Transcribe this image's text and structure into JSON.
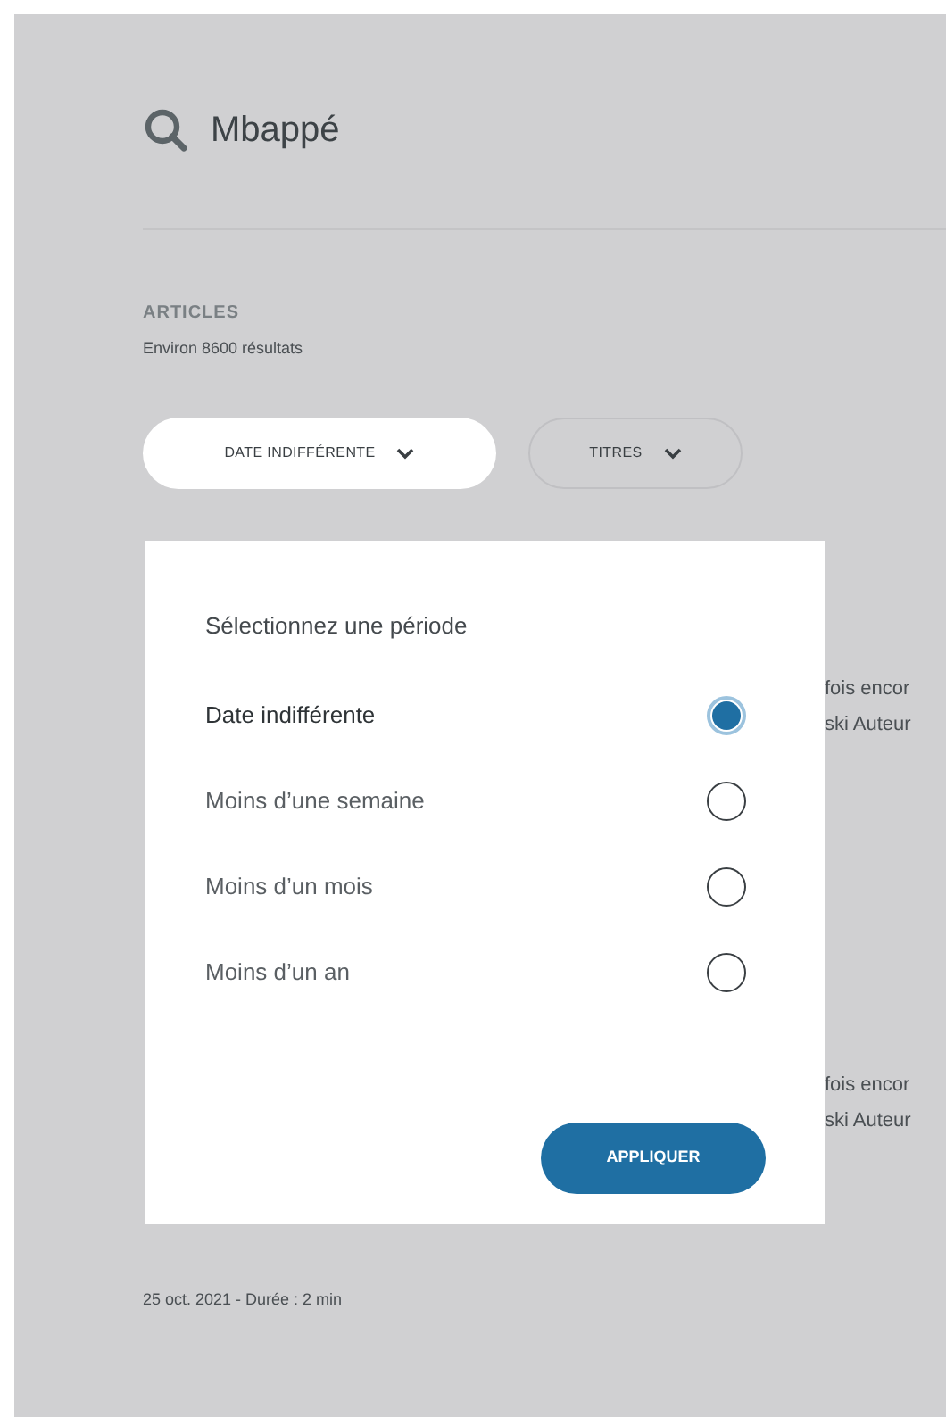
{
  "search": {
    "query": "Mbappé"
  },
  "section": {
    "title": "ARTICLES",
    "count": "Environ 8600 résultats"
  },
  "filters": [
    {
      "label": "DATE INDIFFÉRENTE",
      "selected": true
    },
    {
      "label": "TITRES",
      "selected": false
    }
  ],
  "articles": [
    {
      "lines": [
        "fois encor",
        "ski Auteur"
      ]
    },
    {
      "lines": [
        "fois encor",
        "ski Auteur"
      ]
    },
    {
      "meta": "25 oct. 2021 - Durée : 2 min"
    }
  ],
  "period_menu": {
    "title": "Sélectionnez une période",
    "options": [
      {
        "label": "Date indifférente",
        "selected": true
      },
      {
        "label": "Moins d’une semaine",
        "selected": false
      },
      {
        "label": "Moins d’un mois",
        "selected": false
      },
      {
        "label": "Moins d’un an",
        "selected": false
      }
    ],
    "button": "APPLIQUER"
  }
}
